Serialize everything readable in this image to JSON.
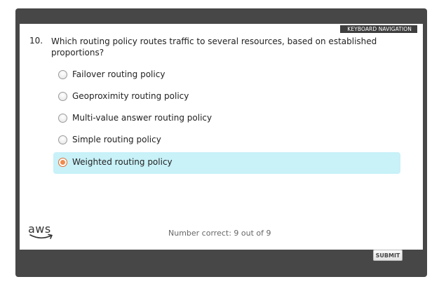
{
  "header": {
    "keyboard_navigation": "KEYBOARD NAVIGATION"
  },
  "question": {
    "number": "10.",
    "text": "Which routing policy routes traffic to several resources, based on established proportions?"
  },
  "options": [
    {
      "label": "Failover routing policy",
      "selected": false
    },
    {
      "label": "Geoproximity routing policy",
      "selected": false
    },
    {
      "label": "Multi-value answer routing policy",
      "selected": false
    },
    {
      "label": "Simple routing policy",
      "selected": false
    },
    {
      "label": "Weighted routing policy",
      "selected": true
    }
  ],
  "footer": {
    "logo_text": "aws",
    "score": "Number correct: 9 out of 9",
    "submit_label": "SUBMIT"
  },
  "colors": {
    "frame": "#474747",
    "selected_bg": "#c8f1f8",
    "radio_selected": "#f08a4b",
    "aws_smile": "#333333"
  }
}
